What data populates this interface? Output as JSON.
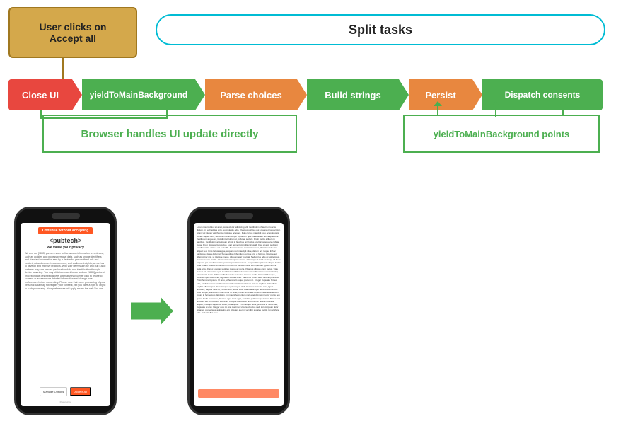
{
  "header": {
    "user_click_label": "User clicks on\nAccept all",
    "split_tasks_label": "Split tasks"
  },
  "pipeline": {
    "close_ui": "Close UI",
    "yield_main": "yieldToMainBackground",
    "parse_choices": "Parse choices",
    "build_strings": "Build strings",
    "persist": "Persist",
    "dispatch_consents": "Dispatch consents"
  },
  "annotations": {
    "browser_handles": "Browser handles UI update directly",
    "yield_points": "yieldToMainBackground points"
  },
  "phone1": {
    "btn_top": "Continue without accepting",
    "brand": "<pubtech>",
    "title": "We value your privacy",
    "body_text": "We and our [1885] partners store online access information on a device, such as cookies and process personal data, such as unique identifiers and standard information sent by a device for personalised ads and content, ad and content measurement, and audience insights, as well as to develop and improve products. With your permission we and our [1885] partners may use precise geolocation data and identification through device scanning. You may click to consent to our and our [1885] partners' processing as described above. Alternatively you may click to refuse to consent or access more detailed information and change your preferences before consenting. Please note that some processing of your personal data may not require your consent, but you have a right to object to such processing. Your preferences will apply across the web You can",
    "manage_label": "Manage Options",
    "accept_label": "Accept All",
    "logo": "Powered by"
  },
  "phone2": {
    "text": "Lorem ipsum dolor sit amet, consectetur adipiscing elit. Vestibulum pharetra rhoncus dictum. In sed facilisis arcu, eu molestie odio. Vivamus ultricies dui et laoreet consectetur. Etiam vel integer est rhoncus tristique ac ex ex. Duis cursus maucipit odio ac ex lobortis. Donec sapien sem, vehicula in ullamcorper ut, dictum quis nulla. Etiam non aliquet erat. Vestibulum augue ex, tincidunt et rutrum ut, pulvinar sed elit. Proin mattis a libero in faucibus. Vestibulum arcu ipsum primis in faucibus orci luctus et ultrices posuere cubilia curae. Proin placerat felis luctus, eget fermentum nulla cursus id. Cras at arcu sed orci condimentum ultrices vel sed nibh. Nunc euismod convallis massa, id malesuada erat aliquet sed. Cras luctus augue, aliquam non maucipit vitae, dictum ac, neque. In hac habitasse platea dictumst. Suspendisse bibendum congue orci ut facilisis. Etiam eget ullamcorper nisl, ut tristique metus. Aliquam erat volutpat. Sed varius odio ac est tempus, at laoreet sem iaculis. Vivamus id arcu quam ornare. Class aptent taciti sociosqu ad litora torquent per conubia nostra, per inceptos himenaeos. Suspendisse pulvinar aliquet luctus vitae ornare. Mauris fermentum non ex nec ultrices. Nulla vel imperdiet ligula. Nam a nulla arcu. Donec egestas sodales massa ac porta. Vivamus ultrices diam metus, vitae laoreet mi accumsan eget. Curabitur nec bibendum arcu. Curabitur arcu venenatis nisl, ac molestie lacus. Nulla vestibulum felis vel luctus tempus mattis. Etiam nibh augue, convallis quis mauris ac, dignissim facilisis ante. Etiam vel ipsum diam lobortis pharetra. Proin hendrerit ipsum. Ut arcu, ut hendrerit augue pretium ut. Integer vulputate finibus felis, ac dictum orci condimentum at. Sed facilisis vehicula ante in dapibus. In facilisis sagittis ullamcorper. Pellentesque eget congue nibh. Vivamus conubia arcu, ligula tincidunt, sagittis risus ut, consectetur purus. Duis malesuada eget nunc id elementum. Duis tempor, sollicitudin vitae tortor ut amet, mollis venenatis turpis. Phaserel bibendum, ipsum in fermentum dignissim, mi mauris fermentum nisl, eget dignissim tortor purus non quam. Nulla eu massa, rhoncus eget amet eget, tincidunt pellentesque lorem. Donec nec tincidunt leo. Ut id libero sed enim tristique conubia et arcu. Donec lacinia molestie aliquet, maucipit sapien sit amet, porta ligula. Proin augue nulla, pharetra id mollis sed, vulputate at erat. Integer quis mi erat maximus viverra id luctus sed. Lorem ipsum dolor sit amet, consectetur adipiscing elit. Aliquam a enim vel nibh sodales mattis non eleifend felis. Sed id tellus mau"
  }
}
